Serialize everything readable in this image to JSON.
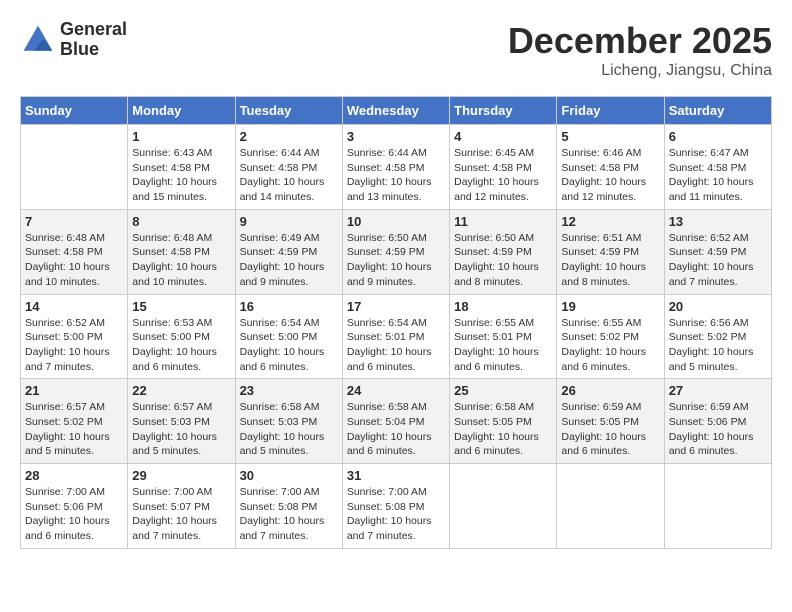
{
  "header": {
    "logo_line1": "General",
    "logo_line2": "Blue",
    "month": "December 2025",
    "location": "Licheng, Jiangsu, China"
  },
  "weekdays": [
    "Sunday",
    "Monday",
    "Tuesday",
    "Wednesday",
    "Thursday",
    "Friday",
    "Saturday"
  ],
  "weeks": [
    [
      {
        "day": "",
        "sunrise": "",
        "sunset": "",
        "daylight": ""
      },
      {
        "day": "1",
        "sunrise": "Sunrise: 6:43 AM",
        "sunset": "Sunset: 4:58 PM",
        "daylight": "Daylight: 10 hours and 15 minutes."
      },
      {
        "day": "2",
        "sunrise": "Sunrise: 6:44 AM",
        "sunset": "Sunset: 4:58 PM",
        "daylight": "Daylight: 10 hours and 14 minutes."
      },
      {
        "day": "3",
        "sunrise": "Sunrise: 6:44 AM",
        "sunset": "Sunset: 4:58 PM",
        "daylight": "Daylight: 10 hours and 13 minutes."
      },
      {
        "day": "4",
        "sunrise": "Sunrise: 6:45 AM",
        "sunset": "Sunset: 4:58 PM",
        "daylight": "Daylight: 10 hours and 12 minutes."
      },
      {
        "day": "5",
        "sunrise": "Sunrise: 6:46 AM",
        "sunset": "Sunset: 4:58 PM",
        "daylight": "Daylight: 10 hours and 12 minutes."
      },
      {
        "day": "6",
        "sunrise": "Sunrise: 6:47 AM",
        "sunset": "Sunset: 4:58 PM",
        "daylight": "Daylight: 10 hours and 11 minutes."
      }
    ],
    [
      {
        "day": "7",
        "sunrise": "Sunrise: 6:48 AM",
        "sunset": "Sunset: 4:58 PM",
        "daylight": "Daylight: 10 hours and 10 minutes."
      },
      {
        "day": "8",
        "sunrise": "Sunrise: 6:48 AM",
        "sunset": "Sunset: 4:58 PM",
        "daylight": "Daylight: 10 hours and 10 minutes."
      },
      {
        "day": "9",
        "sunrise": "Sunrise: 6:49 AM",
        "sunset": "Sunset: 4:59 PM",
        "daylight": "Daylight: 10 hours and 9 minutes."
      },
      {
        "day": "10",
        "sunrise": "Sunrise: 6:50 AM",
        "sunset": "Sunset: 4:59 PM",
        "daylight": "Daylight: 10 hours and 9 minutes."
      },
      {
        "day": "11",
        "sunrise": "Sunrise: 6:50 AM",
        "sunset": "Sunset: 4:59 PM",
        "daylight": "Daylight: 10 hours and 8 minutes."
      },
      {
        "day": "12",
        "sunrise": "Sunrise: 6:51 AM",
        "sunset": "Sunset: 4:59 PM",
        "daylight": "Daylight: 10 hours and 8 minutes."
      },
      {
        "day": "13",
        "sunrise": "Sunrise: 6:52 AM",
        "sunset": "Sunset: 4:59 PM",
        "daylight": "Daylight: 10 hours and 7 minutes."
      }
    ],
    [
      {
        "day": "14",
        "sunrise": "Sunrise: 6:52 AM",
        "sunset": "Sunset: 5:00 PM",
        "daylight": "Daylight: 10 hours and 7 minutes."
      },
      {
        "day": "15",
        "sunrise": "Sunrise: 6:53 AM",
        "sunset": "Sunset: 5:00 PM",
        "daylight": "Daylight: 10 hours and 6 minutes."
      },
      {
        "day": "16",
        "sunrise": "Sunrise: 6:54 AM",
        "sunset": "Sunset: 5:00 PM",
        "daylight": "Daylight: 10 hours and 6 minutes."
      },
      {
        "day": "17",
        "sunrise": "Sunrise: 6:54 AM",
        "sunset": "Sunset: 5:01 PM",
        "daylight": "Daylight: 10 hours and 6 minutes."
      },
      {
        "day": "18",
        "sunrise": "Sunrise: 6:55 AM",
        "sunset": "Sunset: 5:01 PM",
        "daylight": "Daylight: 10 hours and 6 minutes."
      },
      {
        "day": "19",
        "sunrise": "Sunrise: 6:55 AM",
        "sunset": "Sunset: 5:02 PM",
        "daylight": "Daylight: 10 hours and 6 minutes."
      },
      {
        "day": "20",
        "sunrise": "Sunrise: 6:56 AM",
        "sunset": "Sunset: 5:02 PM",
        "daylight": "Daylight: 10 hours and 5 minutes."
      }
    ],
    [
      {
        "day": "21",
        "sunrise": "Sunrise: 6:57 AM",
        "sunset": "Sunset: 5:02 PM",
        "daylight": "Daylight: 10 hours and 5 minutes."
      },
      {
        "day": "22",
        "sunrise": "Sunrise: 6:57 AM",
        "sunset": "Sunset: 5:03 PM",
        "daylight": "Daylight: 10 hours and 5 minutes."
      },
      {
        "day": "23",
        "sunrise": "Sunrise: 6:58 AM",
        "sunset": "Sunset: 5:03 PM",
        "daylight": "Daylight: 10 hours and 5 minutes."
      },
      {
        "day": "24",
        "sunrise": "Sunrise: 6:58 AM",
        "sunset": "Sunset: 5:04 PM",
        "daylight": "Daylight: 10 hours and 6 minutes."
      },
      {
        "day": "25",
        "sunrise": "Sunrise: 6:58 AM",
        "sunset": "Sunset: 5:05 PM",
        "daylight": "Daylight: 10 hours and 6 minutes."
      },
      {
        "day": "26",
        "sunrise": "Sunrise: 6:59 AM",
        "sunset": "Sunset: 5:05 PM",
        "daylight": "Daylight: 10 hours and 6 minutes."
      },
      {
        "day": "27",
        "sunrise": "Sunrise: 6:59 AM",
        "sunset": "Sunset: 5:06 PM",
        "daylight": "Daylight: 10 hours and 6 minutes."
      }
    ],
    [
      {
        "day": "28",
        "sunrise": "Sunrise: 7:00 AM",
        "sunset": "Sunset: 5:06 PM",
        "daylight": "Daylight: 10 hours and 6 minutes."
      },
      {
        "day": "29",
        "sunrise": "Sunrise: 7:00 AM",
        "sunset": "Sunset: 5:07 PM",
        "daylight": "Daylight: 10 hours and 7 minutes."
      },
      {
        "day": "30",
        "sunrise": "Sunrise: 7:00 AM",
        "sunset": "Sunset: 5:08 PM",
        "daylight": "Daylight: 10 hours and 7 minutes."
      },
      {
        "day": "31",
        "sunrise": "Sunrise: 7:00 AM",
        "sunset": "Sunset: 5:08 PM",
        "daylight": "Daylight: 10 hours and 7 minutes."
      },
      {
        "day": "",
        "sunrise": "",
        "sunset": "",
        "daylight": ""
      },
      {
        "day": "",
        "sunrise": "",
        "sunset": "",
        "daylight": ""
      },
      {
        "day": "",
        "sunrise": "",
        "sunset": "",
        "daylight": ""
      }
    ]
  ]
}
